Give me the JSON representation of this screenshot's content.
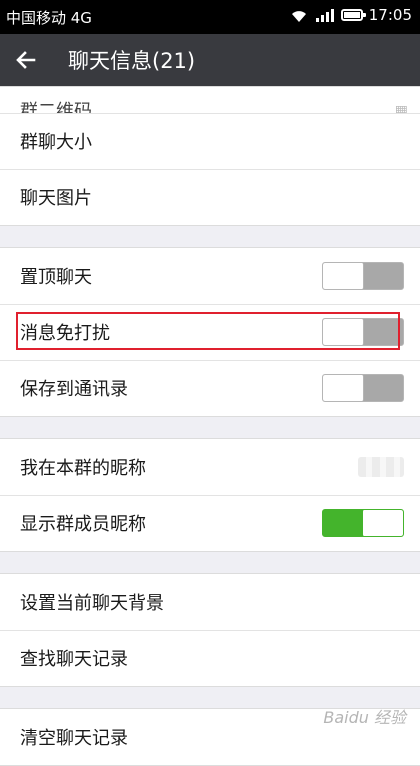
{
  "status_bar": {
    "carrier": "中国移动 4G",
    "time": "17:05"
  },
  "header": {
    "title": "聊天信息(21)",
    "back_icon": "arrow-left-icon"
  },
  "partial_row": {
    "label": "群二维码",
    "value": ""
  },
  "group_info": {
    "size_label": "群聊大小",
    "images_label": "聊天图片"
  },
  "settings": [
    {
      "label": "置顶聊天",
      "toggle": "off"
    },
    {
      "label": "消息免打扰",
      "toggle": "off"
    },
    {
      "label": "保存到通讯录",
      "toggle": "off"
    }
  ],
  "nickname": {
    "label": "我在本群的昵称",
    "value_blurred": true
  },
  "show_names": {
    "label": "显示群成员昵称",
    "toggle": "on"
  },
  "actions": {
    "background_label": "设置当前聊天背景",
    "search_label": "查找聊天记录"
  },
  "clear": {
    "label": "清空聊天记录"
  },
  "colors": {
    "toggle_on": "#44b42c",
    "toggle_off": "#a8a8a8",
    "header_bg": "#393a3f",
    "highlight": "#e0202e"
  },
  "watermark": "Baidu 经验"
}
